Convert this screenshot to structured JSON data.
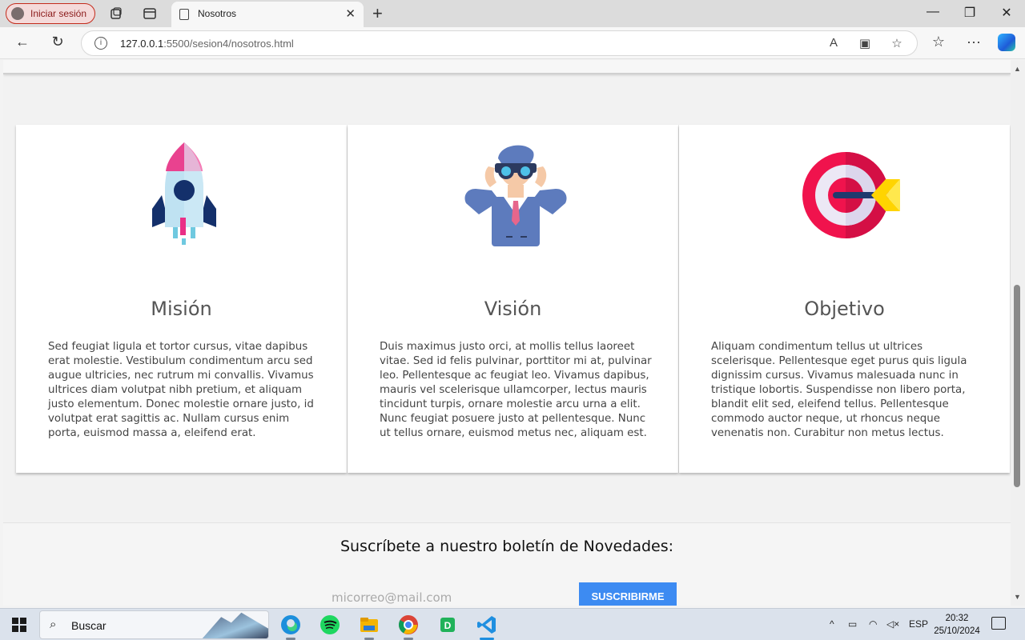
{
  "browser": {
    "profile_label": "Iniciar sesión",
    "tab_title": "Nosotros",
    "url_host": "127.0.0.1",
    "url_rest": ":5500/sesion4/nosotros.html"
  },
  "cards": [
    {
      "title": "Misión",
      "icon": "rocket-icon",
      "text": "Sed feugiat ligula et tortor cursus, vitae dapibus erat molestie. Vestibulum condimentum arcu sed augue ultricies, nec rutrum mi convallis. Vivamus ultrices diam volutpat nibh pretium, et aliquam justo elementum. Donec molestie ornare justo, id volutpat erat sagittis ac. Nullam cursus enim porta, euismod massa a, eleifend erat."
    },
    {
      "title": "Visión",
      "icon": "binoculars-man-icon",
      "text": "Duis maximus justo orci, at mollis tellus laoreet vitae. Sed id felis pulvinar, porttitor mi at, pulvinar leo. Pellentesque ac feugiat leo. Vivamus dapibus, mauris vel scelerisque ullamcorper, lectus mauris tincidunt turpis, ornare molestie arcu urna a elit. Nunc feugiat posuere justo at pellentesque. Nunc ut tellus ornare, euismod metus nec, aliquam est."
    },
    {
      "title": "Objetivo",
      "icon": "target-dart-icon",
      "text": "Aliquam condimentum tellus ut ultrices scelerisque. Pellentesque eget purus quis ligula dignissim cursus. Vivamus malesuada nunc in tristique lobortis. Suspendisse non libero porta, blandit elit sed, eleifend tellus. Pellentesque commodo auctor neque, ut rhoncus neque venenatis non. Curabitur non metus lectus."
    }
  ],
  "newsletter": {
    "heading": "Suscríbete a nuestro boletín de Novedades:",
    "email_placeholder": "micorreo@mail.com",
    "button_label": "SUSCRIBIRME"
  },
  "taskbar": {
    "search_label": "Buscar",
    "language": "ESP",
    "time": "20:32",
    "date": "25/10/2024"
  },
  "colors": {
    "button": "#3d8bf2",
    "profile_border": "#c42b1c"
  }
}
